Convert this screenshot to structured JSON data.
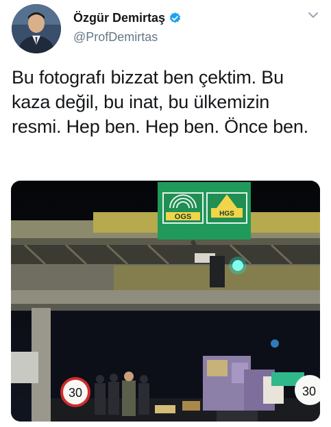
{
  "author": {
    "display_name": "Özgür Demirtaş",
    "handle": "@ProfDemirtas",
    "verified": true,
    "avatar_icon": "profile-photo"
  },
  "tweet": {
    "text": "Bu fotografı bizzat ben çektim. Bu kaza değil, bu inat, bu ülkemizin resmi. Hep ben. Hep ben. Önce ben."
  },
  "media": {
    "sign_left": "OGS",
    "sign_right": "HGS",
    "speed_limit_left": "30",
    "speed_limit_right": "30"
  },
  "colors": {
    "verified_blue": "#1da1f2",
    "handle_gray": "#657786",
    "sign_green": "#1f9a5a"
  }
}
